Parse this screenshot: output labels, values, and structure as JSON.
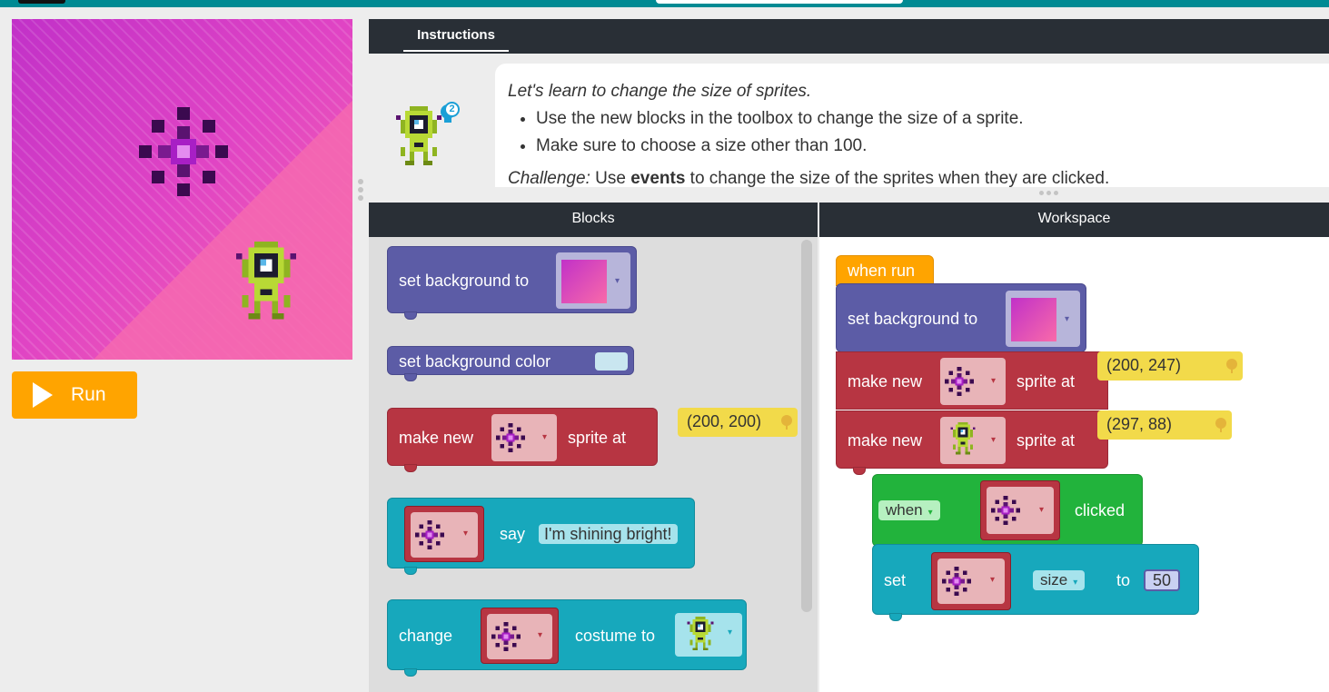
{
  "header": {
    "logo": "logo",
    "progress": "level-progress"
  },
  "run": {
    "label": "Run"
  },
  "instructions": {
    "tab_label": "Instructions",
    "lead": "Let's learn to change the size of sprites.",
    "bullets": [
      "Use the new blocks in the toolbox to change the size of a sprite.",
      "Make sure to choose a size other than 100."
    ],
    "challenge_prefix": "Challenge:",
    "challenge_mid": " Use ",
    "challenge_bold": "events",
    "challenge_rest": " to change the size of the sprites when they are clicked.",
    "hint_count": "2"
  },
  "panes": {
    "blocks": "Blocks",
    "workspace": "Workspace"
  },
  "toolbox": {
    "set_background_label": "set background to",
    "set_background_color_label": "set background color",
    "make_new": "make new",
    "sprite_at": "sprite at",
    "coord": "(200, 200)",
    "say": "say",
    "say_text": "I'm shining bright!",
    "change": "change",
    "costume_to": "costume to"
  },
  "workspace": {
    "when_run": "when run",
    "set_background_label": "set background to",
    "make_new": "make new",
    "sprite_at": "sprite at",
    "coord1": "(200, 247)",
    "coord2": "(297, 88)",
    "when": "when",
    "clicked": "clicked",
    "set": "set",
    "size": "size",
    "to": "to",
    "size_value": "50"
  },
  "colors": {
    "header": "#008a93",
    "run_button": "#ffa400",
    "block_purple": "#5c5ca6",
    "block_red": "#b73542",
    "block_teal": "#17a8bc",
    "block_green": "#22b33c",
    "block_orange": "#ffa400",
    "coordinate_yellow": "#f2da4a"
  },
  "icons": [
    "star-sprite-icon",
    "alien-sprite-icon",
    "play-icon",
    "lightbulb-hint-icon",
    "dropdown-caret-icon",
    "pin-icon"
  ]
}
